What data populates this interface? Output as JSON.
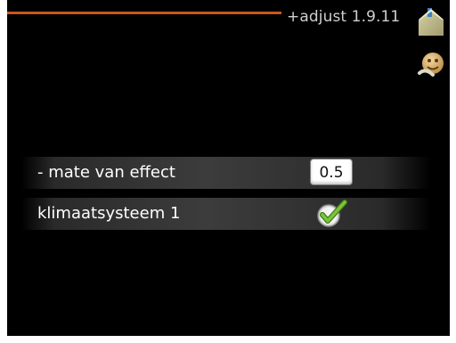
{
  "header": {
    "title": "+adjust 1.9.11",
    "accent_color": "#c9561e"
  },
  "side_icons": [
    {
      "name": "home-icon"
    },
    {
      "name": "smiley-face-icon"
    }
  ],
  "settings": {
    "degree_of_effect": {
      "label": "- mate van effect",
      "value": "0.5"
    },
    "climate_system_1": {
      "label": "klimaatsysteem 1",
      "checked": true,
      "check_color": "#6fb52c"
    }
  }
}
